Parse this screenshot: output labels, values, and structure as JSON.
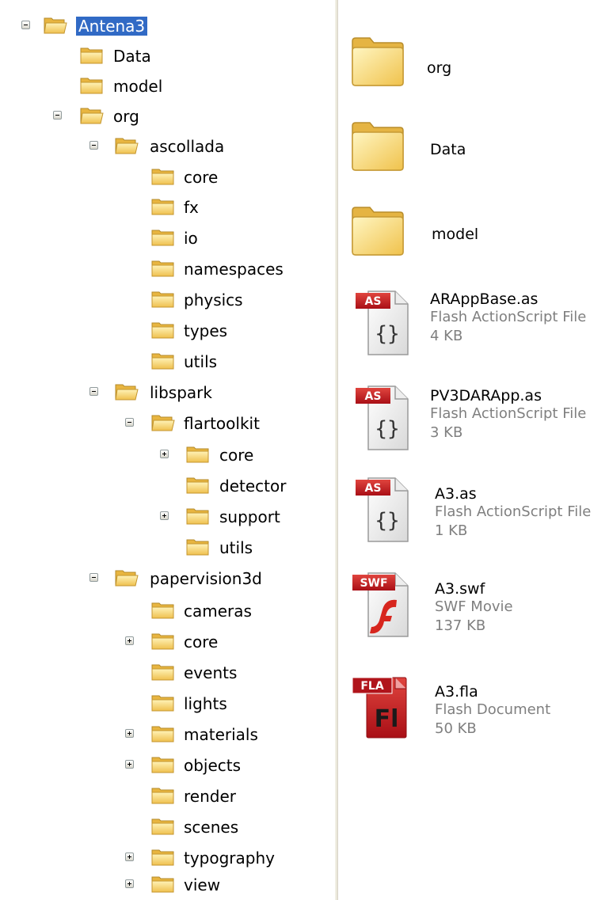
{
  "tree": {
    "nodes": [
      {
        "label": "Antena3",
        "toggle": "minus",
        "selected": true
      },
      {
        "label": "Data",
        "toggle": "none"
      },
      {
        "label": "model",
        "toggle": "none"
      },
      {
        "label": "org",
        "toggle": "minus"
      },
      {
        "label": "ascollada",
        "toggle": "minus"
      },
      {
        "label": "core",
        "toggle": "none"
      },
      {
        "label": "fx",
        "toggle": "none"
      },
      {
        "label": "io",
        "toggle": "none"
      },
      {
        "label": "namespaces",
        "toggle": "none"
      },
      {
        "label": "physics",
        "toggle": "none"
      },
      {
        "label": "types",
        "toggle": "none"
      },
      {
        "label": "utils",
        "toggle": "none"
      },
      {
        "label": "libspark",
        "toggle": "minus"
      },
      {
        "label": "flartoolkit",
        "toggle": "minus"
      },
      {
        "label": "core",
        "toggle": "plus"
      },
      {
        "label": "detector",
        "toggle": "none"
      },
      {
        "label": "support",
        "toggle": "plus"
      },
      {
        "label": "utils",
        "toggle": "none"
      },
      {
        "label": "papervision3d",
        "toggle": "minus"
      },
      {
        "label": "cameras",
        "toggle": "none"
      },
      {
        "label": "core",
        "toggle": "plus"
      },
      {
        "label": "events",
        "toggle": "none"
      },
      {
        "label": "lights",
        "toggle": "none"
      },
      {
        "label": "materials",
        "toggle": "plus"
      },
      {
        "label": "objects",
        "toggle": "plus"
      },
      {
        "label": "render",
        "toggle": "none"
      },
      {
        "label": "scenes",
        "toggle": "none"
      },
      {
        "label": "typography",
        "toggle": "plus"
      },
      {
        "label": "view",
        "toggle": "plus"
      }
    ]
  },
  "content": {
    "folders": [
      {
        "name": "org",
        "icon": "folder-icon"
      },
      {
        "name": "Data",
        "icon": "folder-icon"
      },
      {
        "name": "model",
        "icon": "folder-icon"
      }
    ],
    "files": [
      {
        "name": "ARAppBase.as",
        "type": "Flash ActionScript File",
        "size": "4 KB",
        "icon": "actionscript-file-icon",
        "badge": "AS"
      },
      {
        "name": "PV3DARApp.as",
        "type": "Flash ActionScript File",
        "size": "3 KB",
        "icon": "actionscript-file-icon",
        "badge": "AS"
      },
      {
        "name": "A3.as",
        "type": "Flash ActionScript File",
        "size": "1 KB",
        "icon": "actionscript-file-icon",
        "badge": "AS"
      },
      {
        "name": "A3.swf",
        "type": "SWF Movie",
        "size": "137 KB",
        "icon": "swf-file-icon",
        "badge": "SWF"
      },
      {
        "name": "A3.fla",
        "type": "Flash Document",
        "size": "50 KB",
        "icon": "fla-file-icon",
        "badge": "FLA",
        "glyph": "Fl"
      }
    ]
  },
  "colors": {
    "selection": "#316ac5",
    "folder": "#f7d36b",
    "badge_red": "#c4161c",
    "meta_text": "#7f7f7f"
  }
}
